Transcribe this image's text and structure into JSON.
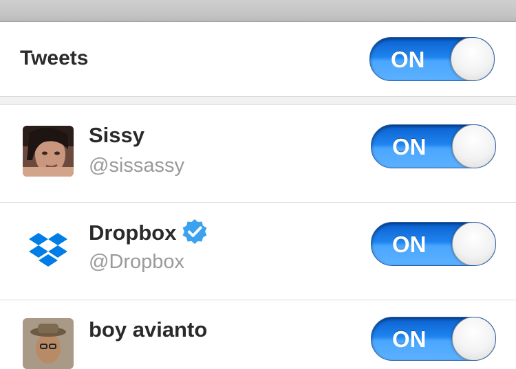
{
  "header": {},
  "tweets_setting": {
    "label": "Tweets",
    "toggle": {
      "label": "ON",
      "state": "on"
    }
  },
  "accounts": [
    {
      "name": "Sissy",
      "handle": "@sissassy",
      "verified": false,
      "avatar": "photo-avatar-icon",
      "toggle": {
        "label": "ON",
        "state": "on"
      }
    },
    {
      "name": "Dropbox",
      "handle": "@Dropbox",
      "verified": true,
      "avatar": "dropbox-logo-icon",
      "toggle": {
        "label": "ON",
        "state": "on"
      }
    },
    {
      "name": "boy avianto",
      "handle": "",
      "verified": false,
      "avatar": "photo-avatar-icon",
      "toggle": {
        "label": "ON",
        "state": "on"
      }
    }
  ],
  "colors": {
    "switch_on": "#1f84ee",
    "verified_badge": "#3ba2ef",
    "dropbox_blue": "#007ee5",
    "handle_gray": "#9a9a9a"
  }
}
